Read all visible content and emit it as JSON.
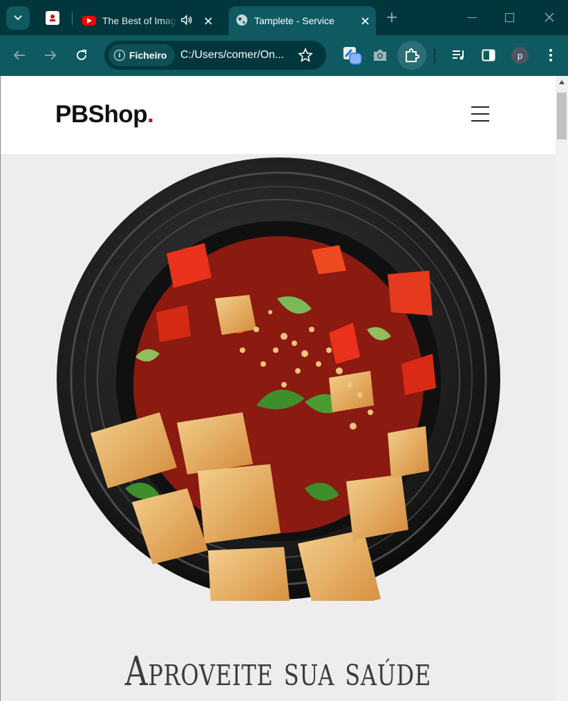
{
  "browser": {
    "tabs": [
      {
        "title": "",
        "favicon": "pbshop-favicon"
      },
      {
        "title": "The Best of Imag",
        "favicon": "youtube-icon",
        "audio_icon": "speaker-icon"
      },
      {
        "title": "Tamplete - Service",
        "favicon": "globe-icon",
        "active": true
      }
    ],
    "security_chip": "Ficheiro",
    "url": "C:/Users/comer/On...",
    "profile_initial": "p"
  },
  "site": {
    "logo_text": "PBShop",
    "logo_dot": ".",
    "hero_title": "Aproveite sua saúde",
    "hero_image": "plate-of-fried-tofu-with-red-peppers-peanuts-and-herbs"
  },
  "colors": {
    "browser_frame": "#00363c",
    "toolbar": "#0e5a60",
    "logo_accent": "#c0171c",
    "page_bg": "#ededed"
  }
}
